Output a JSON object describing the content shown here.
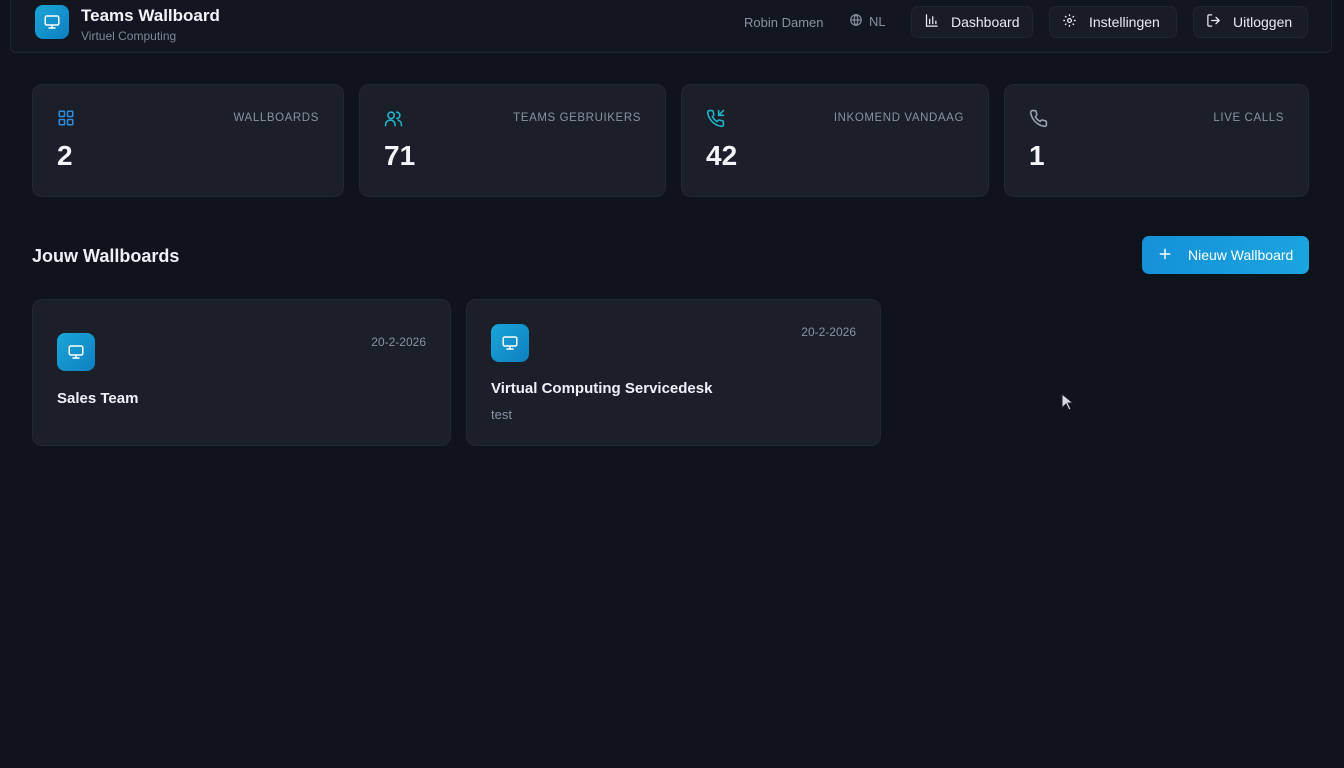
{
  "header": {
    "title": "Teams Wallboard",
    "subtitle": "Virtuel Computing",
    "user_name": "Robin Damen",
    "language": "NL",
    "nav": {
      "dashboard": "Dashboard",
      "settings": "Instellingen",
      "logout": "Uitloggen"
    }
  },
  "stats": [
    {
      "label": "WALLBOARDS",
      "value": "2",
      "icon": "grid-icon",
      "color": "#2f8de0"
    },
    {
      "label": "TEAMS GEBRUIKERS",
      "value": "71",
      "icon": "users-icon",
      "color": "#21b3c7"
    },
    {
      "label": "INKOMEND VANDAAG",
      "value": "42",
      "icon": "phone-incoming-icon",
      "color": "#21b3c7"
    },
    {
      "label": "LIVE CALLS",
      "value": "1",
      "icon": "phone-icon",
      "color": "#9aa1b0"
    }
  ],
  "section": {
    "title": "Jouw Wallboards",
    "new_button": "Nieuw Wallboard"
  },
  "wallboards": [
    {
      "name": "Sales Team",
      "date": "20-2-2026",
      "description": ""
    },
    {
      "name": "Virtual Computing Servicedesk",
      "date": "20-2-2026",
      "description": "test"
    }
  ],
  "colors": {
    "accent": "#1a9fdc",
    "background": "#0f131c",
    "card": "#1b1f2a"
  }
}
